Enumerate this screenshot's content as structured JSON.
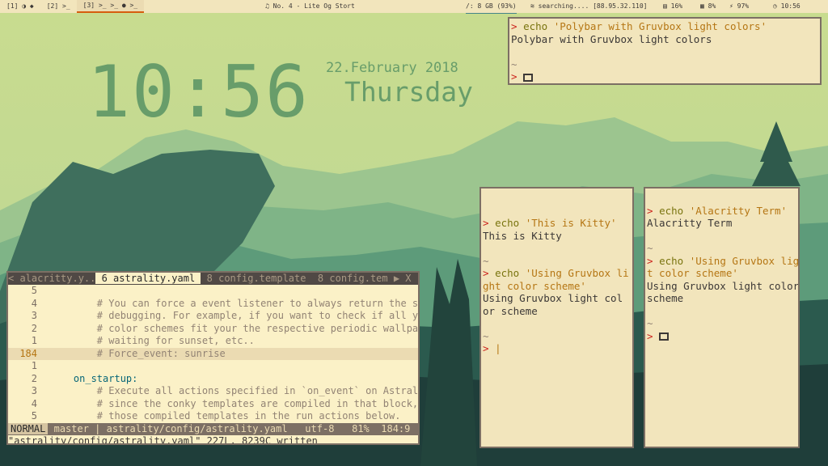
{
  "polybar": {
    "workspaces": [
      {
        "label": "[1]",
        "icons": "◑ ◆"
      },
      {
        "label": "[2]",
        "icons": ">_"
      },
      {
        "label": "[3]",
        "icons": ">_ >_ ● >_"
      }
    ],
    "now_playing": "No. 4 - Lite Og Stort",
    "disk": "/: 8 GB (93%)",
    "wifi": "searching.... [88.95.32.110]",
    "memory": "16%",
    "cpu": "8%",
    "battery": "97%",
    "time": "10:56"
  },
  "desktop": {
    "clock": "10:56",
    "date": "22.February 2018",
    "day": "Thursday"
  },
  "polybar_term": {
    "command": "echo 'Polybar with Gruvbox light colors'",
    "cmd_word": "echo",
    "cmd_arg": "'Polybar with Gruvbox light colors'",
    "output": "Polybar with Gruvbox light colors",
    "tilde": "~",
    "prompt": ">"
  },
  "kitty": {
    "blocks": [
      {
        "cmd_word": "echo",
        "cmd_arg": "'This is Kitty'",
        "output": [
          "This is Kitty"
        ]
      },
      {
        "cmd_word": "echo",
        "cmd_arg": "'Using Gruvbox li",
        "output": [
          "ght color scheme'",
          "Using Gruvbox light col",
          "or scheme"
        ]
      }
    ],
    "tilde": "~",
    "prompt": ">"
  },
  "alacritty": {
    "blocks": [
      {
        "cmd_word": "echo",
        "cmd_arg": "'Alacritty Term'",
        "output": [
          "Alacritty Term"
        ]
      },
      {
        "cmd_word": "echo",
        "cmd_arg": "'Using Gruvbox ligh",
        "output": [
          "t color scheme'",
          "Using Gruvbox light color",
          "scheme"
        ]
      }
    ],
    "tilde": "~",
    "prompt": ">"
  },
  "vim": {
    "tabs": [
      "< alacritty.y..",
      " 6 astrality.yaml ",
      " 8 config.template ",
      " 8 config.tem ",
      "▶ X"
    ],
    "lines": [
      {
        "num": "5",
        "text": ""
      },
      {
        "num": "4",
        "text": "        # You can force a event listener to always return the sa"
      },
      {
        "num": "3",
        "text": "        # debugging. For example, if you want to check if all yo"
      },
      {
        "num": "2",
        "text": "        # color schemes fit your the respective periodic wallpap"
      },
      {
        "num": "1",
        "text": "        # waiting for sunset, etc.."
      },
      {
        "num": "184",
        "text": "        # Force_event: sunrise",
        "current": true
      },
      {
        "num": "1",
        "text": ""
      },
      {
        "num": "2",
        "text": "    on_startup:",
        "key": true
      },
      {
        "num": "3",
        "text": "        # Execute all actions specified in `on_event` on Astrali"
      },
      {
        "num": "4",
        "text": "        # since the conky templates are compiled in that block,"
      },
      {
        "num": "5",
        "text": "        # those compiled templates in the run actions below."
      }
    ],
    "status": {
      "mode": "NORMAL",
      "branch": "master",
      "file": "astrality/config/astrality.yaml",
      "encoding": "utf-8",
      "percent": "81%",
      "position": "184:9"
    },
    "cmdline": "\"astrality/config/astrality.yaml\" 227L, 8239C written"
  },
  "colors": {
    "sky": "#c7db8f",
    "bg_light": "#f2e5bc",
    "clock": "#689d6a",
    "prompt": "#cc241d",
    "string": "#b57614"
  }
}
